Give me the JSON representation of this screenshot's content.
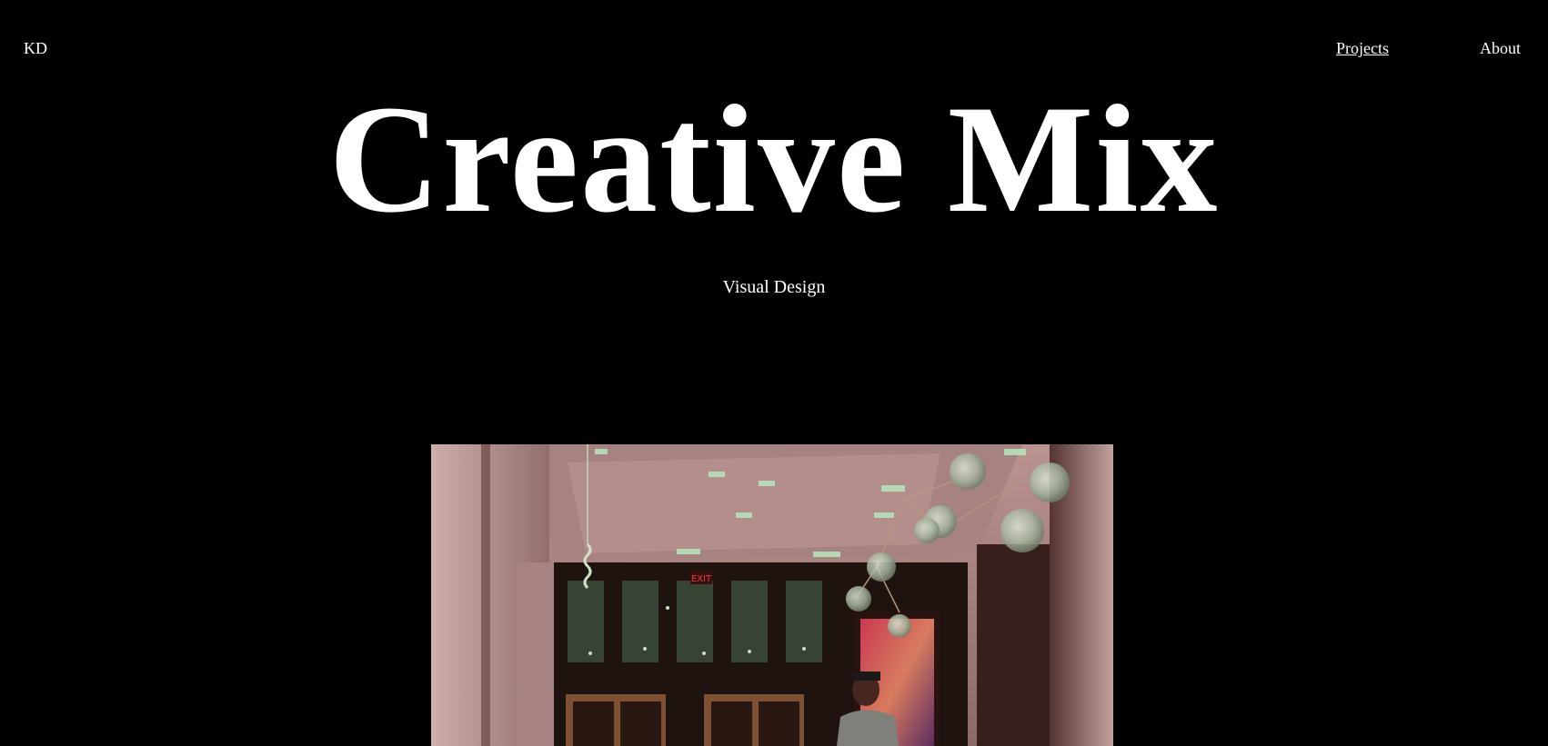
{
  "header": {
    "logo": "KD",
    "nav": [
      {
        "label": "Projects",
        "active": true
      },
      {
        "label": "About",
        "active": false
      }
    ]
  },
  "hero": {
    "title": "Creative Mix",
    "subtitle": "Visual Design"
  },
  "photo": {
    "exit_sign": "EXIT"
  },
  "colors": {
    "background": "#000000",
    "text": "#ffffff",
    "photo_wall": "#b08a88",
    "photo_dark": "#1b1410"
  }
}
